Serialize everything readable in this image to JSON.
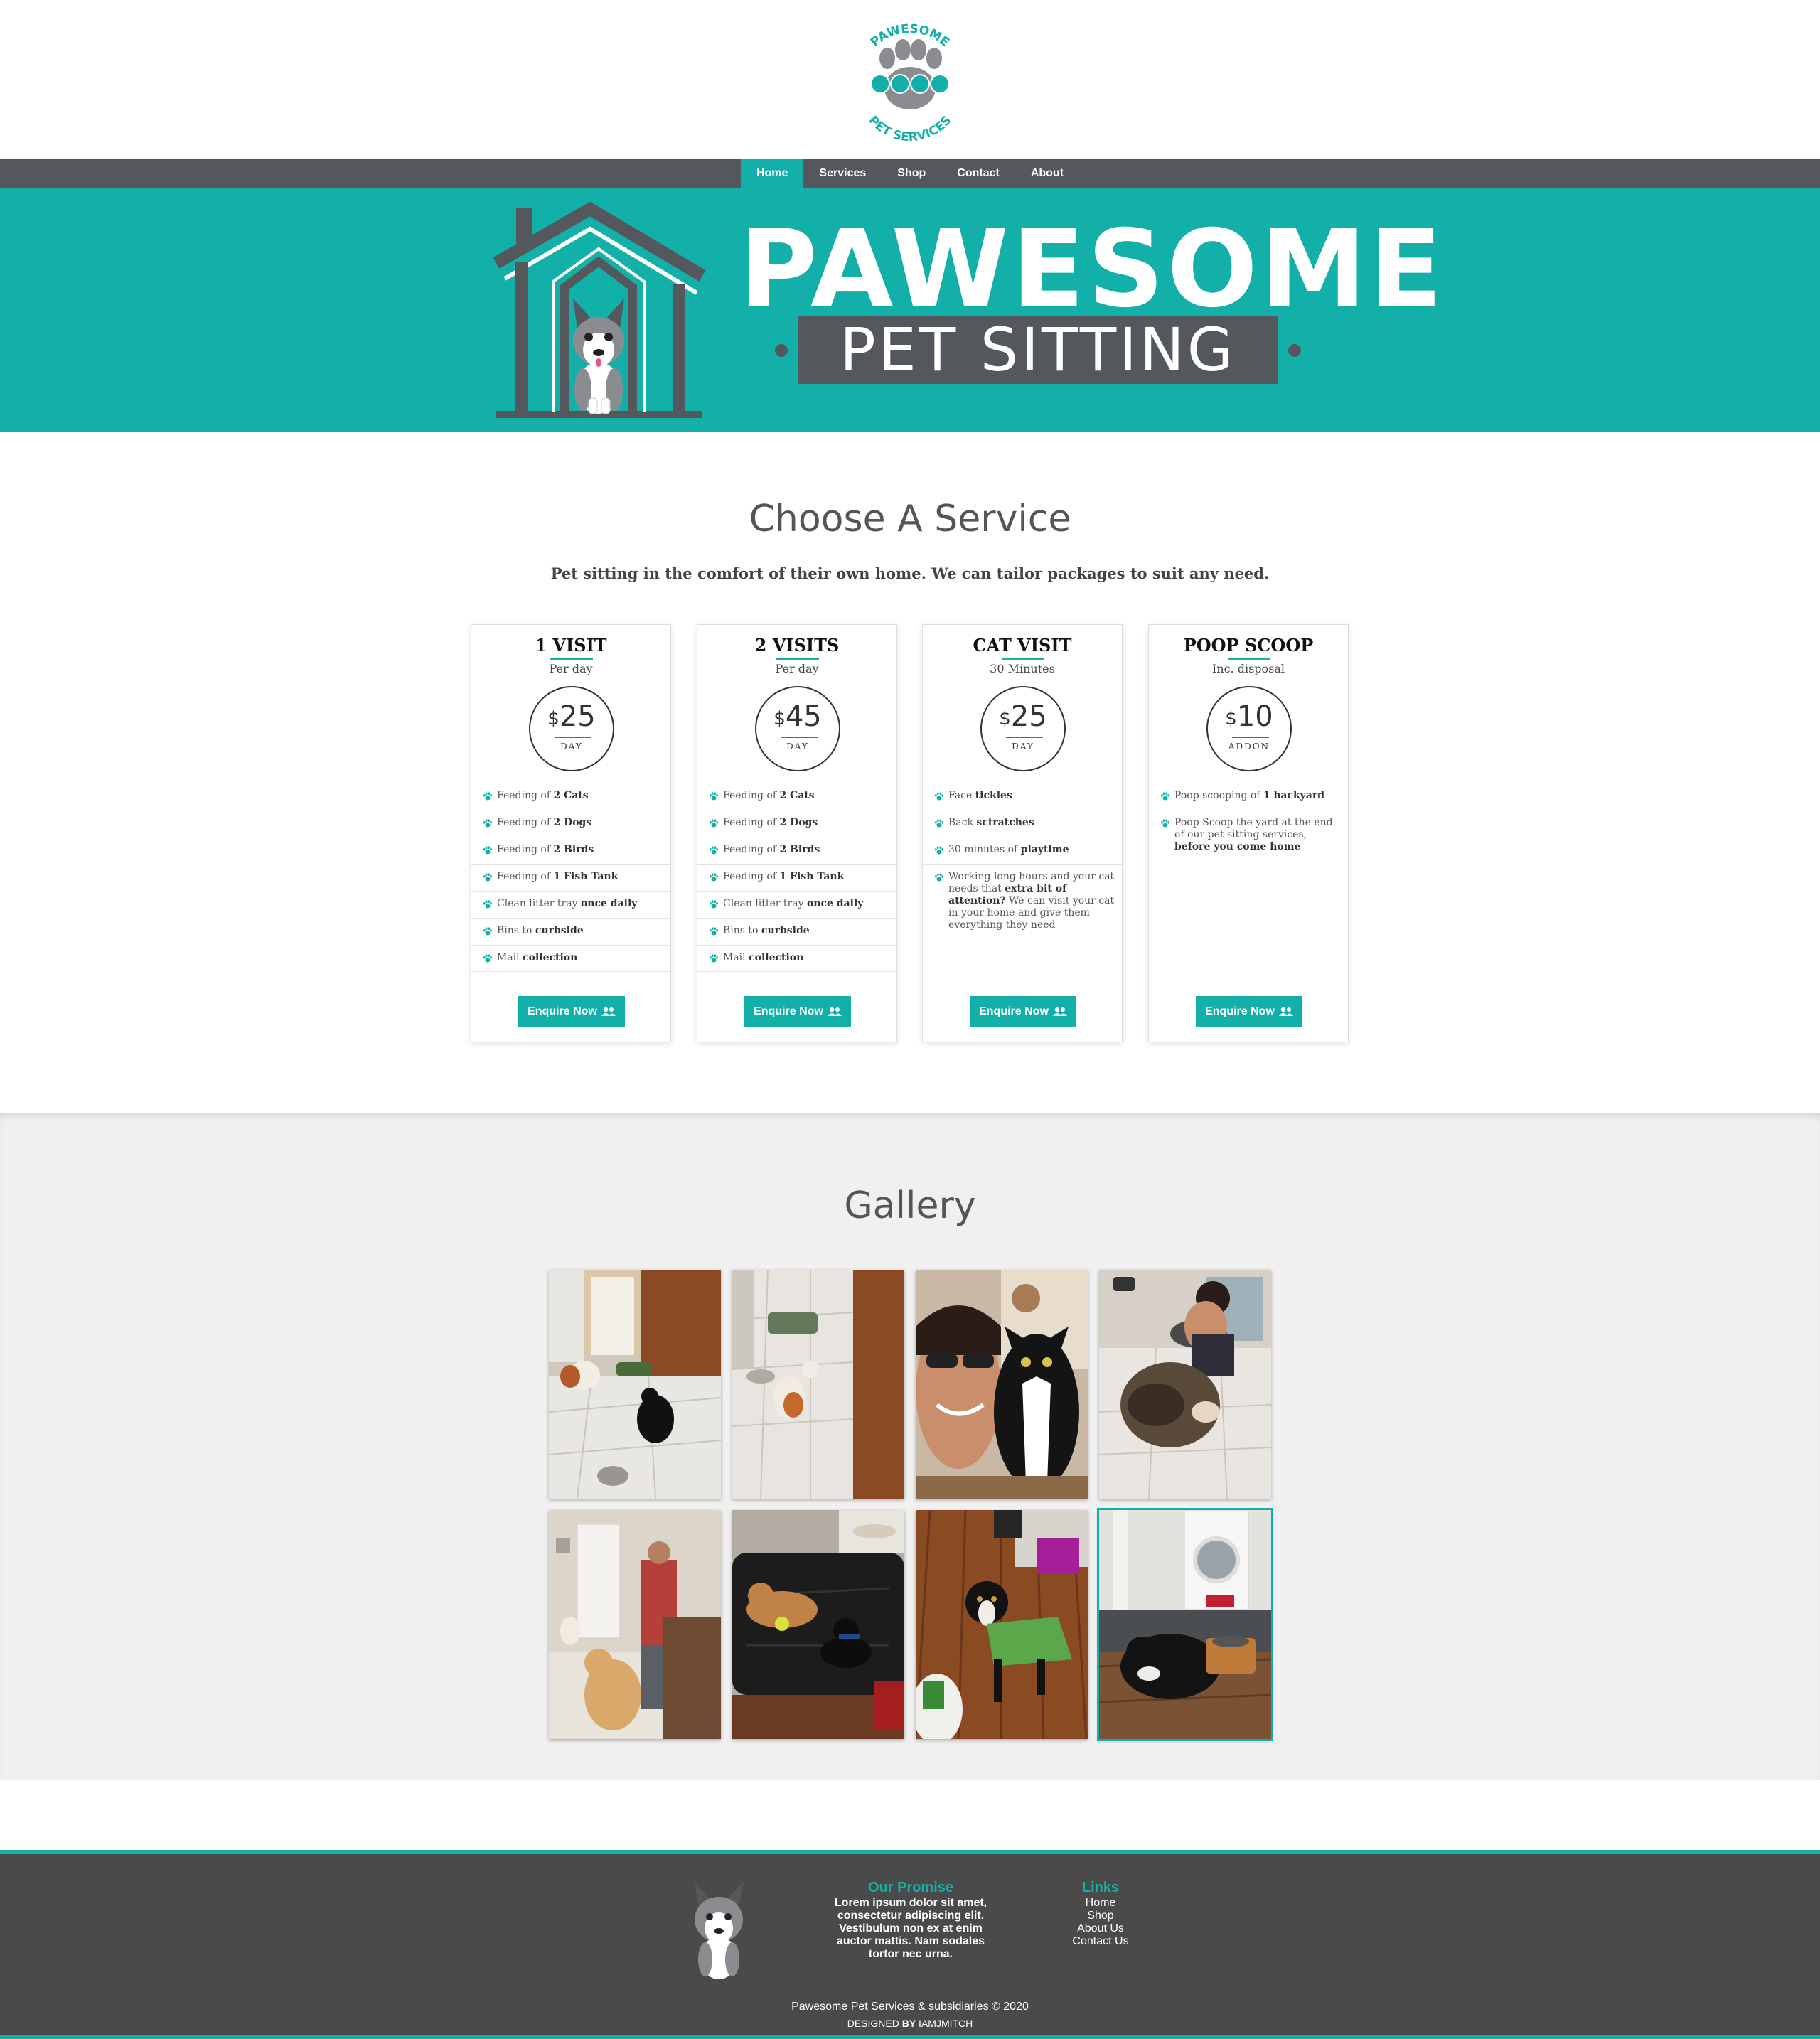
{
  "brand": {
    "logo_top": "PAWESOME",
    "logo_bottom": "PET SERVICES",
    "hero_title": "PAWESOME",
    "hero_subtitle": "PET SITTING"
  },
  "nav": {
    "items": [
      {
        "label": "Home",
        "active": true
      },
      {
        "label": "Services",
        "active": false
      },
      {
        "label": "Shop",
        "active": false
      },
      {
        "label": "Contact",
        "active": false
      },
      {
        "label": "About",
        "active": false
      }
    ]
  },
  "services": {
    "title": "Choose A Service",
    "subtitle": "Pet sitting in the comfort of their own home. We can tailor packages to suit any need.",
    "cards": [
      {
        "name": "1 VISIT",
        "per": "Per day",
        "currency": "$",
        "price": "25",
        "unit": "DAY",
        "features": [
          {
            "pre": "Feeding of ",
            "bold": "2 Cats",
            "post": ""
          },
          {
            "pre": "Feeding of ",
            "bold": "2 Dogs",
            "post": ""
          },
          {
            "pre": "Feeding of ",
            "bold": "2 Birds",
            "post": ""
          },
          {
            "pre": "Feeding of ",
            "bold": "1 Fish Tank",
            "post": ""
          },
          {
            "pre": "Clean litter tray ",
            "bold": "once daily",
            "post": ""
          },
          {
            "pre": "Bins to ",
            "bold": "curbside",
            "post": ""
          },
          {
            "pre": "Mail ",
            "bold": "collection",
            "post": ""
          }
        ],
        "button": "Enquire Now"
      },
      {
        "name": "2 VISITS",
        "per": "Per day",
        "currency": "$",
        "price": "45",
        "unit": "DAY",
        "features": [
          {
            "pre": "Feeding of ",
            "bold": "2 Cats",
            "post": ""
          },
          {
            "pre": "Feeding of ",
            "bold": "2 Dogs",
            "post": ""
          },
          {
            "pre": "Feeding of ",
            "bold": "2 Birds",
            "post": ""
          },
          {
            "pre": "Feeding of ",
            "bold": "1 Fish Tank",
            "post": ""
          },
          {
            "pre": "Clean litter tray ",
            "bold": "once daily",
            "post": ""
          },
          {
            "pre": "Bins to ",
            "bold": "curbside",
            "post": ""
          },
          {
            "pre": "Mail ",
            "bold": "collection",
            "post": ""
          }
        ],
        "button": "Enquire Now"
      },
      {
        "name": "CAT VISIT",
        "per": "30 Minutes",
        "currency": "$",
        "price": "25",
        "unit": "DAY",
        "features": [
          {
            "pre": "Face ",
            "bold": "tickles",
            "post": ""
          },
          {
            "pre": "Back ",
            "bold": "sctratches",
            "post": ""
          },
          {
            "pre": "30 minutes of ",
            "bold": "playtime",
            "post": ""
          },
          {
            "pre": "Working long hours and your cat needs that ",
            "bold": "extra bit of attention?",
            "post": " We can visit your cat in your home and give them everything they need"
          }
        ],
        "button": "Enquire Now"
      },
      {
        "name": "POOP SCOOP",
        "per": "Inc. disposal",
        "currency": "$",
        "price": "10",
        "unit": "ADDON",
        "features": [
          {
            "pre": "Poop scooping of ",
            "bold": "1 backyard",
            "post": ""
          },
          {
            "pre": "Poop Scoop the yard at the end of our pet sitting services, ",
            "bold": "before you come home",
            "post": ""
          }
        ],
        "button": "Enquire Now"
      }
    ]
  },
  "gallery": {
    "title": "Gallery"
  },
  "footer": {
    "promise_title": "Our Promise",
    "promise_text": "Lorem ipsum dolor sit amet, consectetur adipiscing elit. Vestibulum non ex at enim auctor mattis. Nam sodales tortor nec urna.",
    "links_title": "Links",
    "links": [
      "Home",
      "Shop",
      "About Us",
      "Contact Us"
    ],
    "copyright": "Pawesome Pet Services & subsidiaries © 2020",
    "designed_pre": "DESIGNED ",
    "designed_by": "BY",
    "designed_name": " IAMJMITCH"
  },
  "colors": {
    "accent": "#12b0a8",
    "dark": "#54575c",
    "footer": "#4a4a4a",
    "gallery_bg": "#f0f0f0"
  }
}
